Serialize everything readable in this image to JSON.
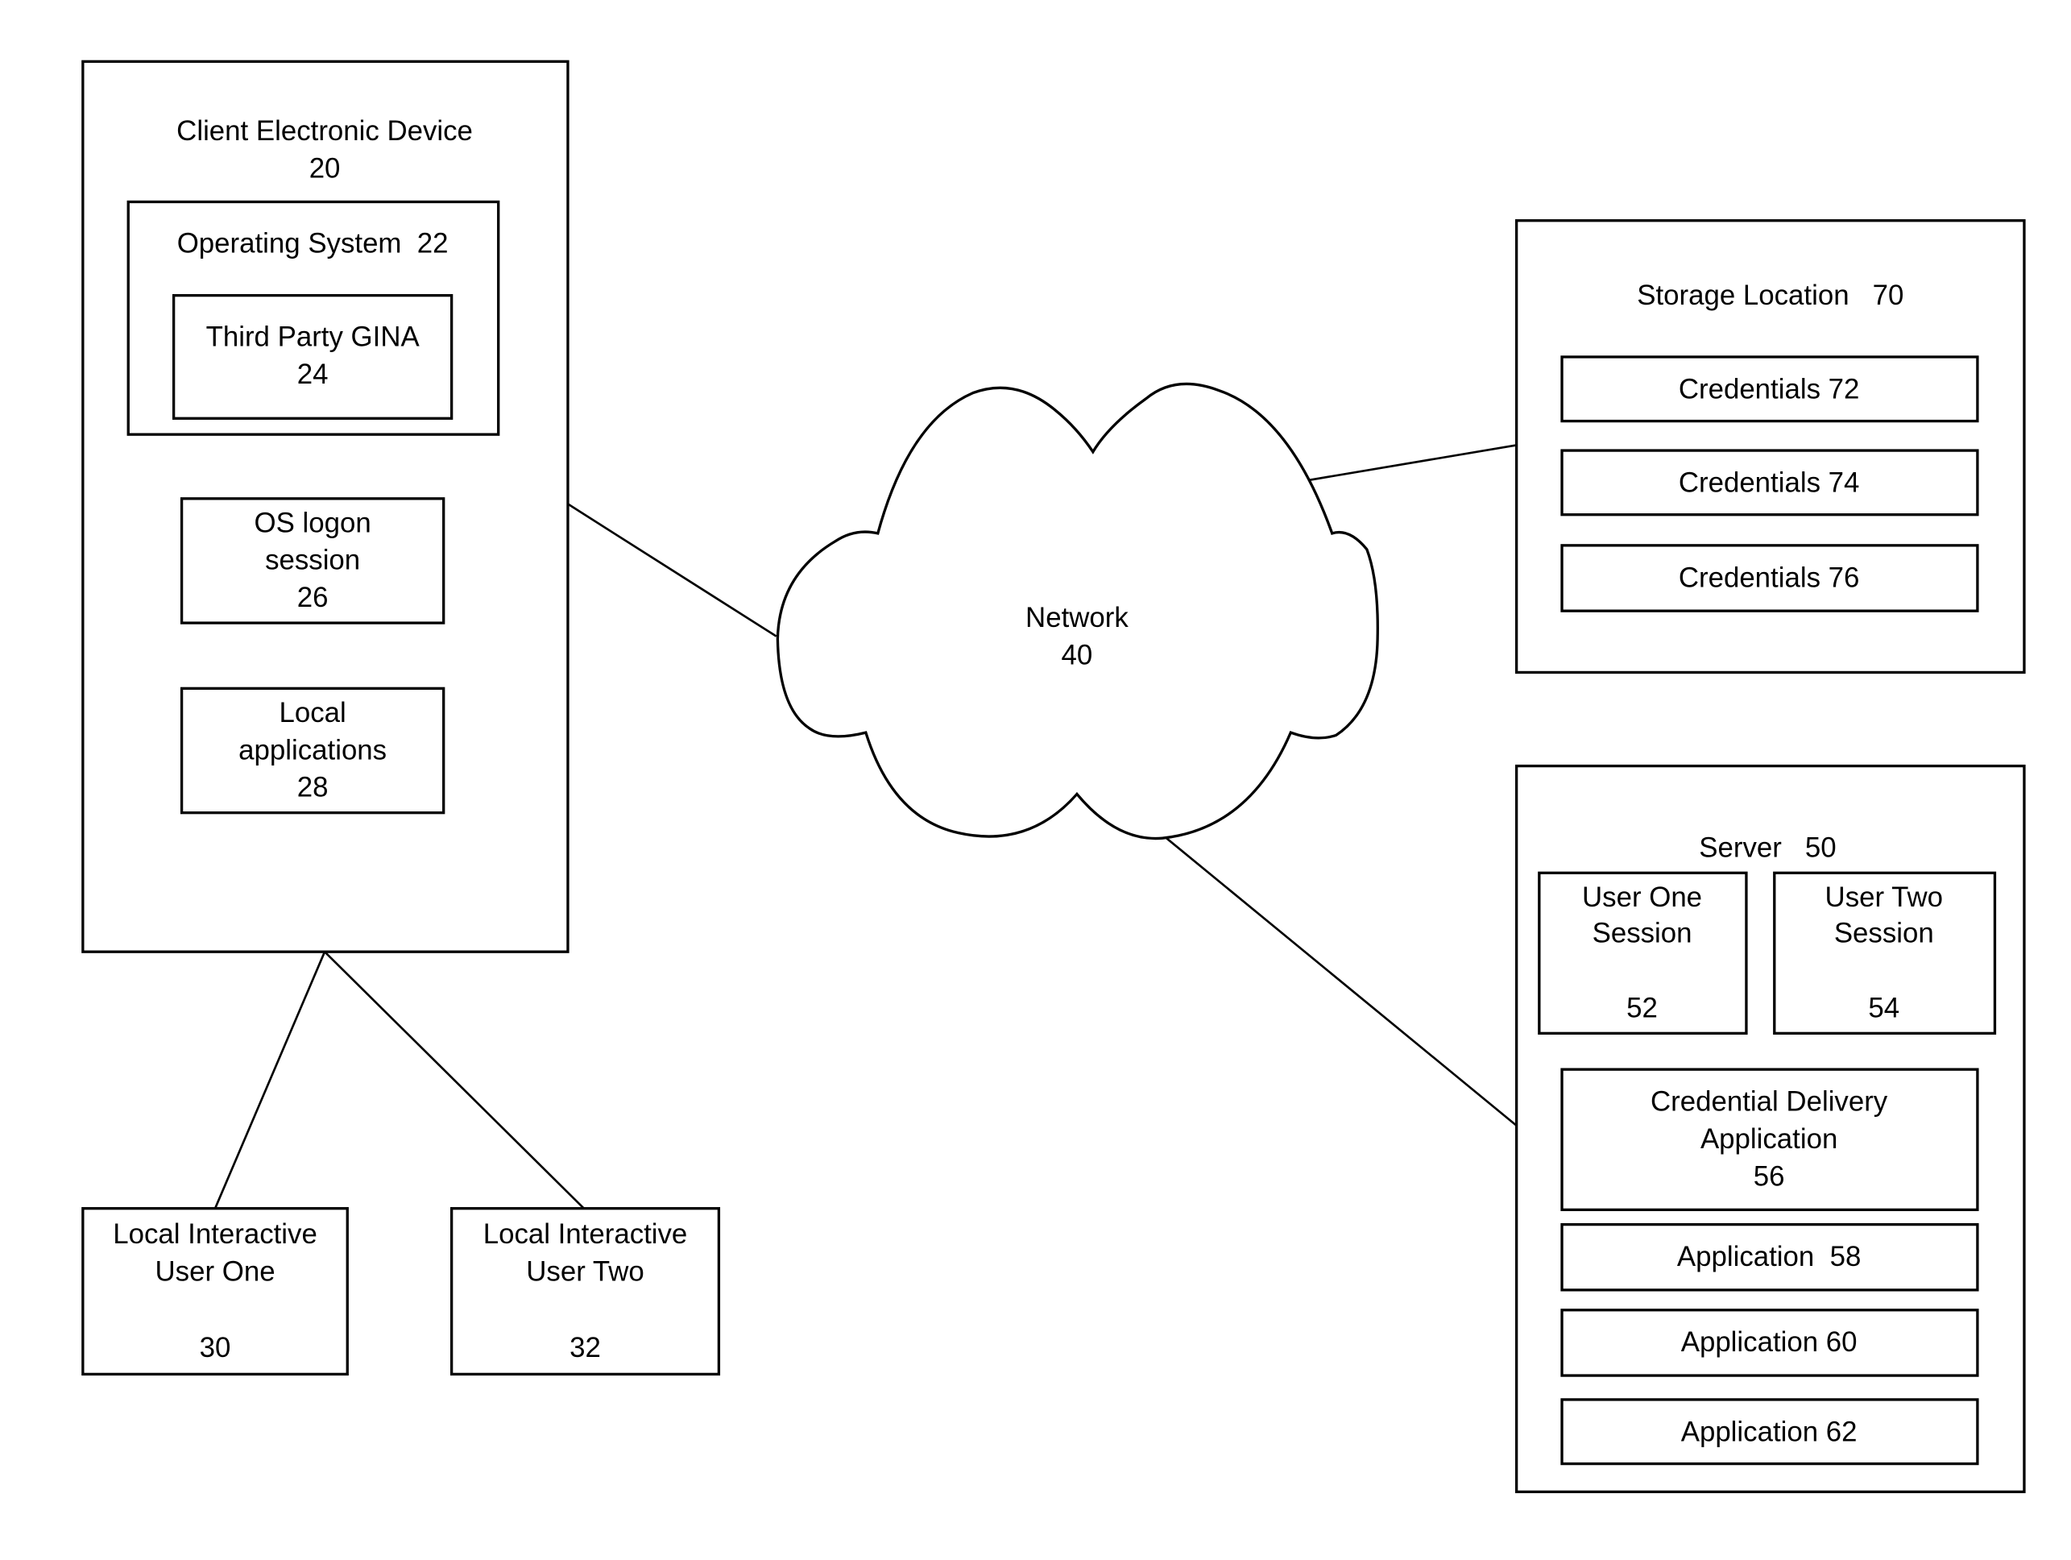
{
  "diagram": {
    "client": {
      "title": "Client Electronic Device",
      "number": "20",
      "os": {
        "label": "Operating System  22",
        "gina": {
          "line1": "Third Party GINA",
          "line2": "24"
        }
      },
      "logon": {
        "line1": "OS logon",
        "line2": "session",
        "line3": "26"
      },
      "localapps": {
        "line1": "Local",
        "line2": "applications",
        "line3": "28"
      }
    },
    "users": [
      {
        "line1": "Local Interactive",
        "line2": "User One",
        "number": "30"
      },
      {
        "line1": "Local Interactive",
        "line2": "User Two",
        "number": "32"
      }
    ],
    "network": {
      "line1": "Network",
      "line2": "40"
    },
    "storage": {
      "title": "Storage Location   70",
      "credentials": [
        "Credentials 72",
        "Credentials 74",
        "Credentials 76"
      ]
    },
    "server": {
      "title": "Server   50",
      "sessions": [
        {
          "line1": "User One",
          "line2": "Session",
          "number": "52"
        },
        {
          "line1": "User Two",
          "line2": "Session",
          "number": "54"
        }
      ],
      "delivery": {
        "line1": "Credential Delivery",
        "line2": "Application",
        "line3": "56"
      },
      "apps": [
        "Application  58",
        "Application 60",
        "Application 62"
      ]
    }
  }
}
